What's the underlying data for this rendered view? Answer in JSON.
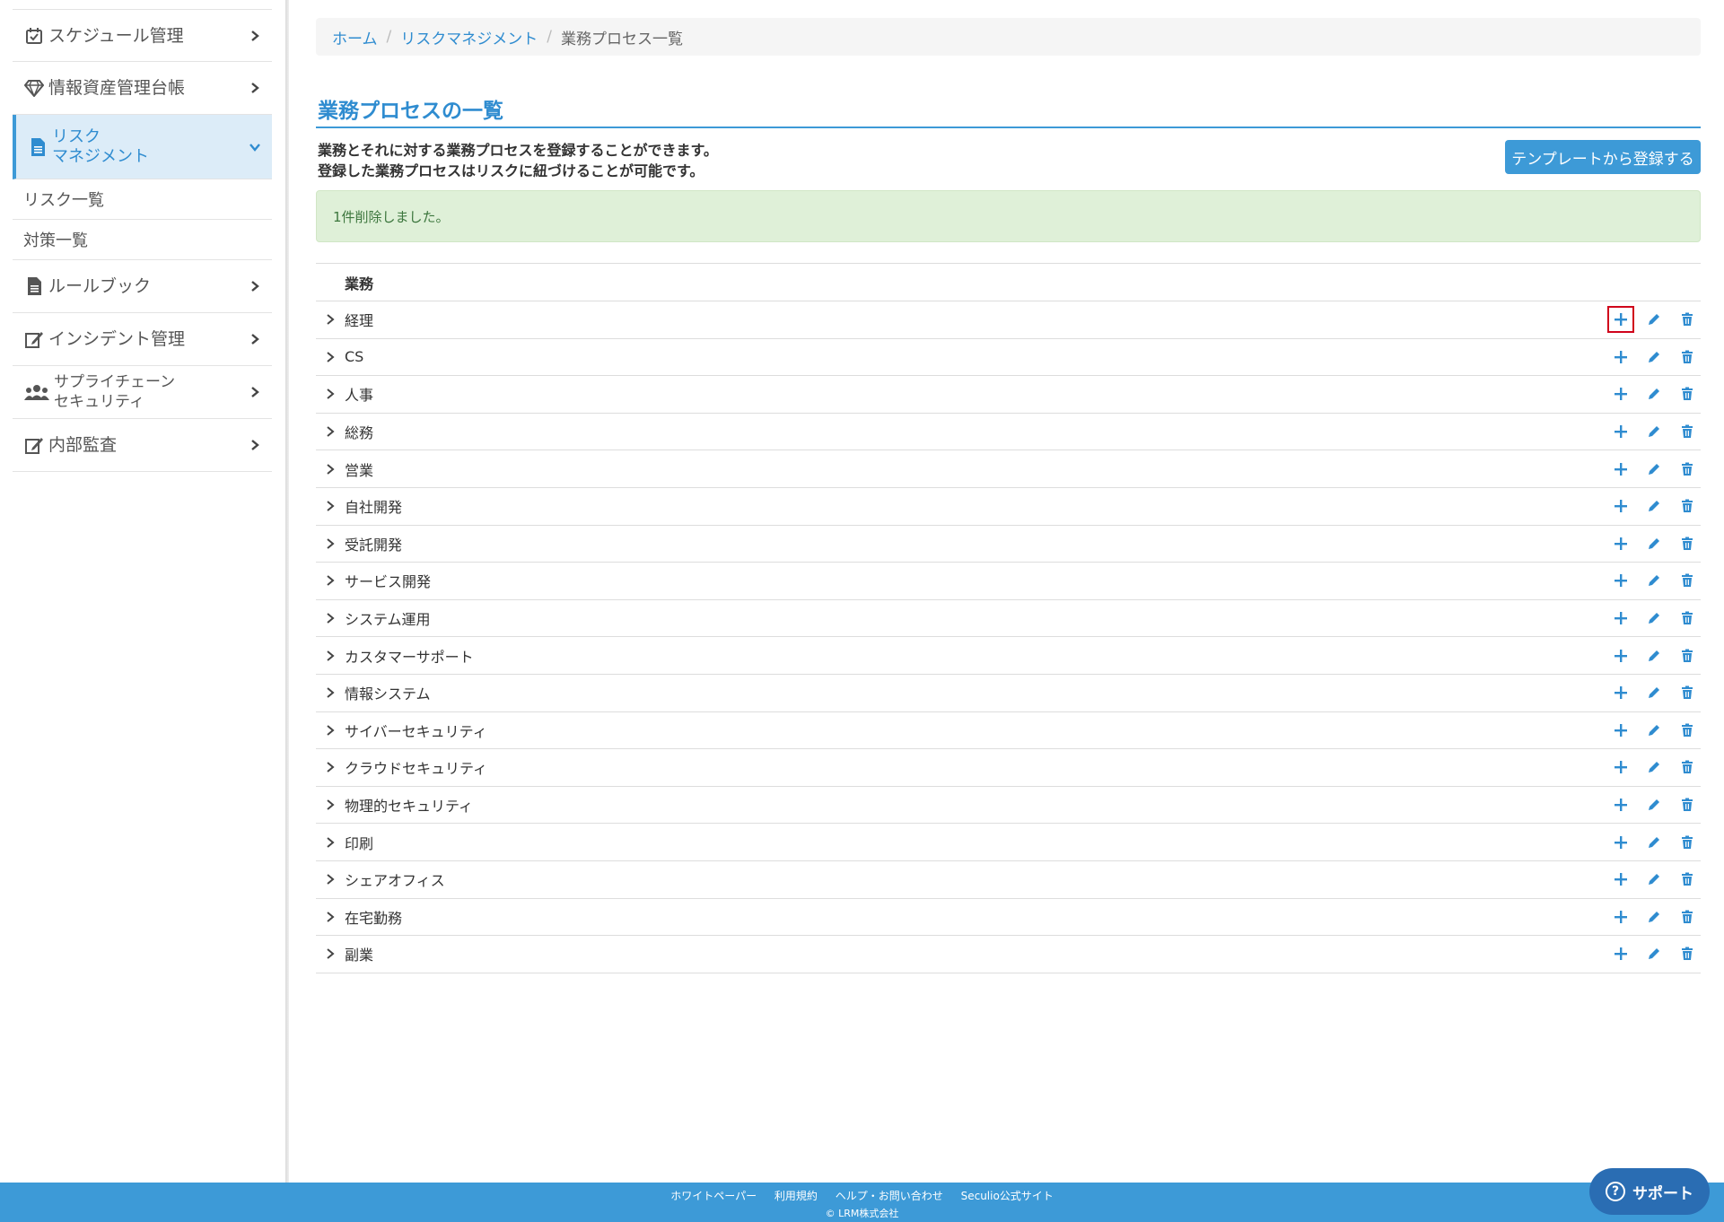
{
  "sidebar": {
    "items": [
      {
        "label": "スケジュール管理",
        "icon": "calendar-check-icon"
      },
      {
        "label": "情報資産管理台帳",
        "icon": "diamond-icon"
      },
      {
        "label_line1": "リスク",
        "label_line2": "マネジメント",
        "icon": "document-icon",
        "active": true
      },
      {
        "label": "ルールブック",
        "icon": "file-icon"
      },
      {
        "label": "インシデント管理",
        "icon": "edit-icon"
      },
      {
        "label_line1": "サプライチェーン",
        "label_line2": "セキュリティ",
        "icon": "users-icon"
      },
      {
        "label": "内部監査",
        "icon": "edit-icon"
      }
    ],
    "sub_items": [
      "リスク一覧",
      "対策一覧"
    ]
  },
  "breadcrumb": {
    "home": "ホーム",
    "parent": "リスクマネジメント",
    "current": "業務プロセス一覧"
  },
  "page": {
    "title": "業務プロセスの一覧",
    "desc_line1": "業務とそれに対する業務プロセスを登録することができます。",
    "desc_line2": "登録した業務プロセスはリスクに紐づけることが可能です。",
    "template_button": "テンプレートから登録する",
    "alert": "1件削除しました。"
  },
  "table": {
    "header": "業務",
    "rows": [
      "経理",
      "CS",
      "人事",
      "総務",
      "営業",
      "自社開発",
      "受託開発",
      "サービス開発",
      "システム運用",
      "カスタマーサポート",
      "情報システム",
      "サイバーセキュリティ",
      "クラウドセキュリティ",
      "物理的セキュリティ",
      "印刷",
      "シェアオフィス",
      "在宅勤務",
      "副業"
    ]
  },
  "footer": {
    "links": [
      "ホワイトペーパー",
      "利用規約",
      "ヘルプ・お問い合わせ",
      "Seculio公式サイト"
    ],
    "copyright": "© LRM株式会社"
  },
  "support": {
    "label": "サポート"
  },
  "colors": {
    "accent": "#3d9ad7",
    "highlight": "#d0021b",
    "alert_bg": "#dff0d8"
  }
}
